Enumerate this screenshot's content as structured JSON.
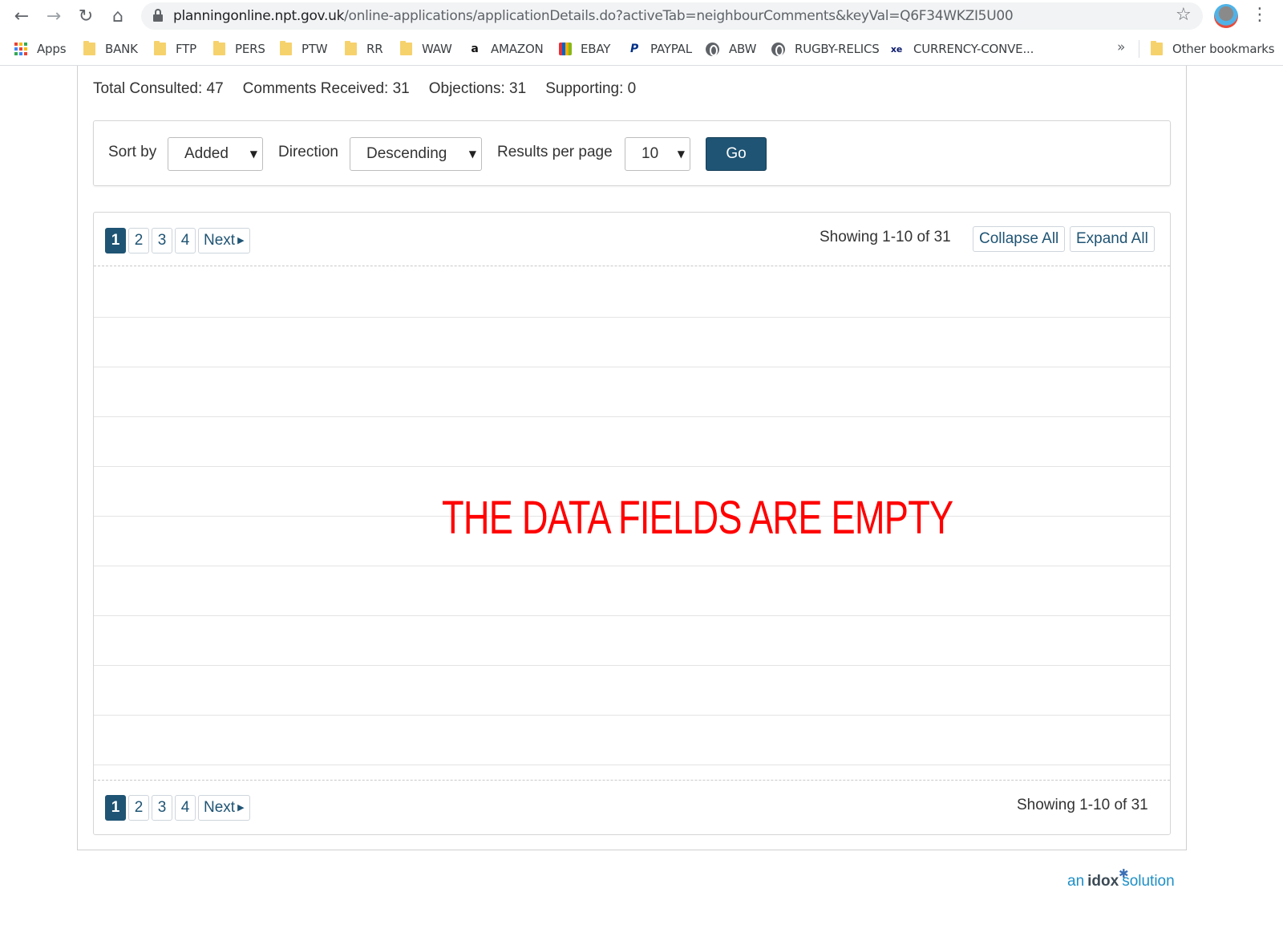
{
  "browser": {
    "url_host": "planningonline.npt.gov.uk",
    "url_path": "/online-applications/applicationDetails.do?activeTab=neighbourComments&keyVal=Q6F34WKZI5U00",
    "bookmarks": [
      "Apps",
      "BANK",
      "FTP",
      "PERS",
      "PTW",
      "RR",
      "WAW",
      "AMAZON",
      "EBAY",
      "PAYPAL",
      "ABW",
      "RUGBY-RELICS",
      "CURRENCY-CONVE...",
      "Other bookmarks"
    ],
    "overflow_label": "»"
  },
  "stats": {
    "total_consulted": "Total Consulted: 47",
    "comments_received": "Comments Received: 31",
    "objections": "Objections: 31",
    "supporting": "Supporting: 0"
  },
  "sort": {
    "sort_by_label": "Sort by",
    "sort_by_value": "Added",
    "direction_label": "Direction",
    "direction_value": "Descending",
    "results_label": "Results per page",
    "results_value": "10",
    "go_label": "Go"
  },
  "pager": {
    "pages": [
      "1",
      "2",
      "3",
      "4"
    ],
    "next_label": "Next",
    "showing": "Showing 1-10 of 31",
    "collapse_all": "Collapse All",
    "expand_all": "Expand All"
  },
  "annotation": "THE DATA FIELDS ARE EMPTY",
  "footer": {
    "an": "an",
    "idox": "idox",
    "solution": "solution"
  },
  "colors": {
    "primary": "#1f5474",
    "annotation": "#ff0000",
    "idox_blue": "#1e8fc7"
  }
}
